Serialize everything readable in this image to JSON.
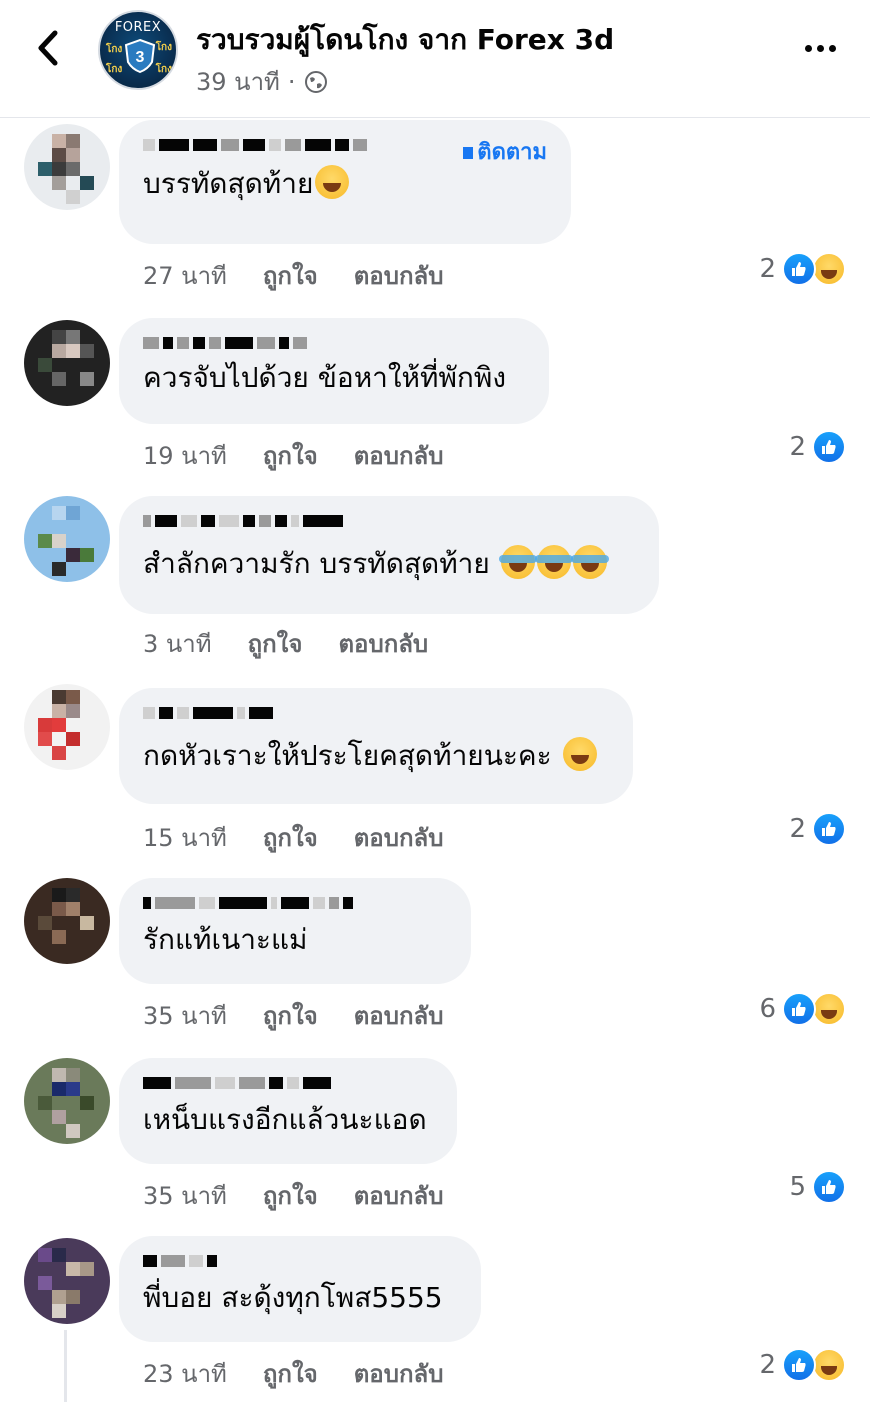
{
  "header": {
    "title": "รวบรวมผู้โดนโกง จาก Forex 3d",
    "time": "39 นาที",
    "separator": "·",
    "avatar_brand": "FOREX",
    "avatar_tag": "โกง",
    "avatar_letter": "3"
  },
  "labels": {
    "like": "ถูกใจ",
    "reply": "ตอบกลับ",
    "follow": "ติดตาม"
  },
  "colors": {
    "accent": "#1877f2",
    "bubble": "#f0f2f5",
    "meta": "#65676b"
  },
  "comments": [
    {
      "text": "บรรทัดสุดท้าย",
      "emojis": [
        "laughing-emoji"
      ],
      "time": "27 นาที",
      "reaction_count": "2",
      "reactions": [
        "like",
        "haha"
      ],
      "follow_visible": true
    },
    {
      "text": "ควรจับไปด้วย ข้อหาให้ที่พักพิง",
      "emojis": [],
      "time": "19 นาที",
      "reaction_count": "2",
      "reactions": [
        "like"
      ]
    },
    {
      "text": "สำลักความรัก บรรทัดสุดท้าย",
      "emojis": [
        "tears-of-joy-emoji",
        "tears-of-joy-emoji",
        "tears-of-joy-emoji"
      ],
      "time": "3 นาที",
      "reaction_count": "",
      "reactions": []
    },
    {
      "text": "กดหัวเราะให้ประโยคสุดท้ายนะคะ",
      "emojis": [
        "rolling-laughing-emoji"
      ],
      "time": "15 นาที",
      "reaction_count": "2",
      "reactions": [
        "like"
      ]
    },
    {
      "text": "รักแท้เนาะแม่",
      "emojis": [],
      "time": "35 นาที",
      "reaction_count": "6",
      "reactions": [
        "like",
        "haha"
      ]
    },
    {
      "text": "เหน็บแรงอีกแล้วนะแอด",
      "emojis": [],
      "time": "35 นาที",
      "reaction_count": "5",
      "reactions": [
        "like"
      ]
    },
    {
      "text": "พี่บอย สะดุ้งทุกโพส5555",
      "emojis": [],
      "time": "23 นาที",
      "reaction_count": "2",
      "reactions": [
        "like",
        "haha"
      ]
    }
  ]
}
